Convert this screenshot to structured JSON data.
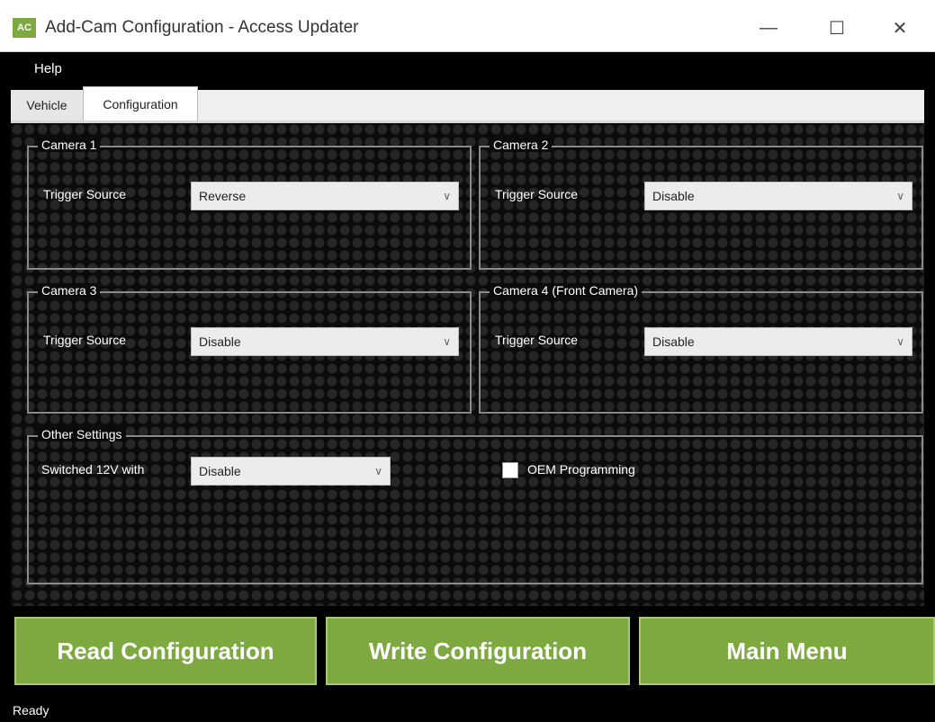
{
  "window": {
    "title": "Add-Cam Configuration - Access Updater",
    "icon_label": "AC",
    "minimize": "—",
    "maximize": "☐",
    "close": "✕"
  },
  "menu": {
    "help": "Help"
  },
  "tabs": [
    {
      "label": "Vehicle"
    },
    {
      "label": "Configuration"
    }
  ],
  "cameras": [
    {
      "legend": "Camera 1",
      "label": "Trigger Source",
      "value": "Reverse"
    },
    {
      "legend": "Camera 2",
      "label": "Trigger Source",
      "value": "Disable"
    },
    {
      "legend": "Camera 3",
      "label": "Trigger Source",
      "value": "Disable"
    },
    {
      "legend": "Camera 4 (Front Camera)",
      "label": "Trigger Source",
      "value": "Disable"
    }
  ],
  "other": {
    "legend": "Other Settings",
    "switched_label": "Switched 12V with",
    "switched_value": "Disable",
    "oem_label": "OEM Programming"
  },
  "buttons": {
    "read": "Read Configuration",
    "write": "Write Configuration",
    "main": "Main Menu"
  },
  "status": "Ready",
  "colors": {
    "accent": "#7ea940"
  }
}
